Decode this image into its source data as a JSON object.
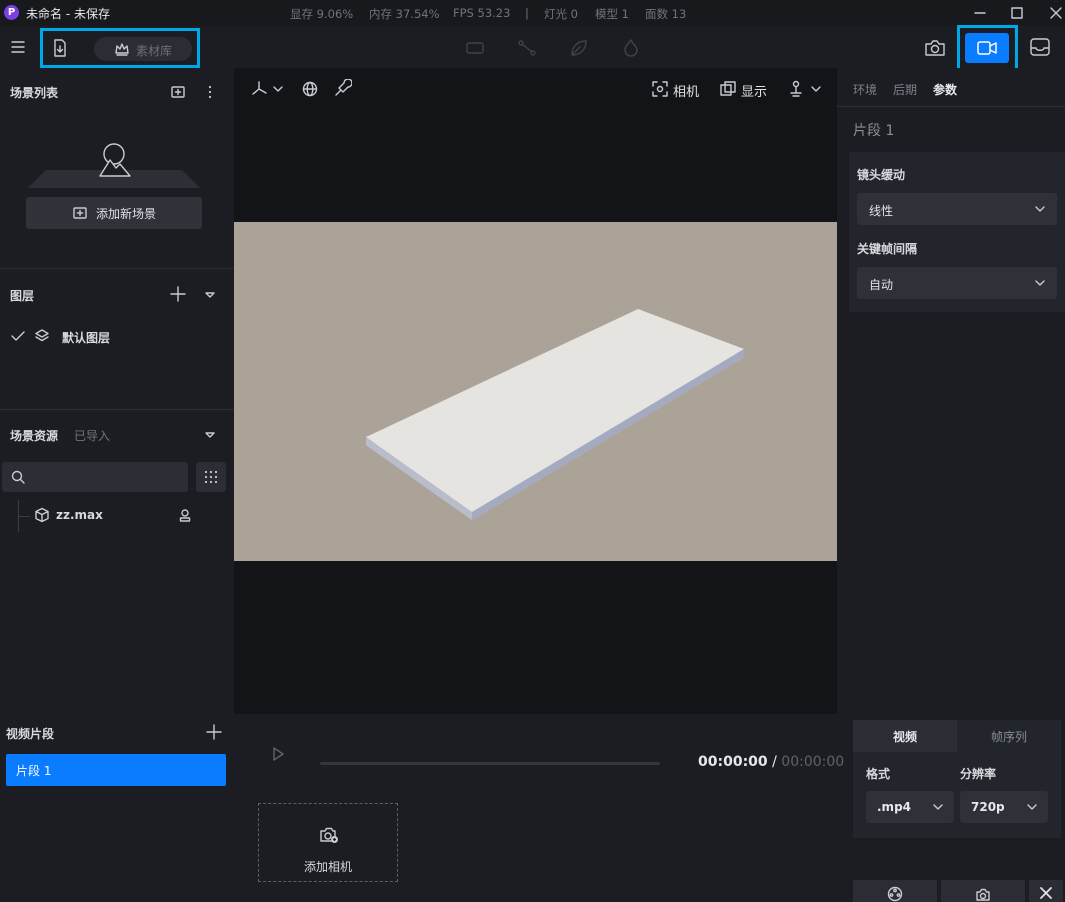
{
  "app": {
    "logo_letter": "P",
    "window_title": "未命名 - 未保存"
  },
  "stats": {
    "vram": "显存 9.06%",
    "memory": "内存 37.54%",
    "fps": "FPS 53.23",
    "separator": "|",
    "lights": "灯光 0",
    "models": "模型 1",
    "faces": "面数 13"
  },
  "toolbar": {
    "library_label": "素材库",
    "accent_color": "#0a7cff",
    "highlight_color": "#00a8e8"
  },
  "scene_list": {
    "title": "场景列表",
    "add_scene_label": "添加新场景"
  },
  "layers": {
    "title": "图层",
    "items": [
      {
        "label": "默认图层",
        "checked": true
      }
    ]
  },
  "scene_assets": {
    "title": "场景资源",
    "imported_label": "已导入",
    "search_placeholder": "",
    "files": [
      {
        "name": "zz.max"
      }
    ]
  },
  "viewport": {
    "camera_label": "相机",
    "display_label": "显示"
  },
  "right_panel": {
    "tabs": [
      "环境",
      "后期",
      "参数"
    ],
    "active_tab": "参数",
    "clip_title": "片段 1",
    "easing_label": "镜头缓动",
    "easing_value": "线性",
    "keyframe_label": "关键帧间隔",
    "keyframe_value": "自动"
  },
  "video_clips": {
    "title": "视频片段",
    "items": [
      {
        "label": "片段 1",
        "selected": true
      }
    ]
  },
  "timeline": {
    "current_time": "00:00:00",
    "separator": "/",
    "total_time": "00:00:00",
    "add_camera_label": "添加相机"
  },
  "export": {
    "tabs": [
      "视频",
      "帧序列"
    ],
    "active_tab": "视频",
    "format_label": "格式",
    "format_value": ".mp4",
    "resolution_label": "分辨率",
    "resolution_value": "720p"
  }
}
